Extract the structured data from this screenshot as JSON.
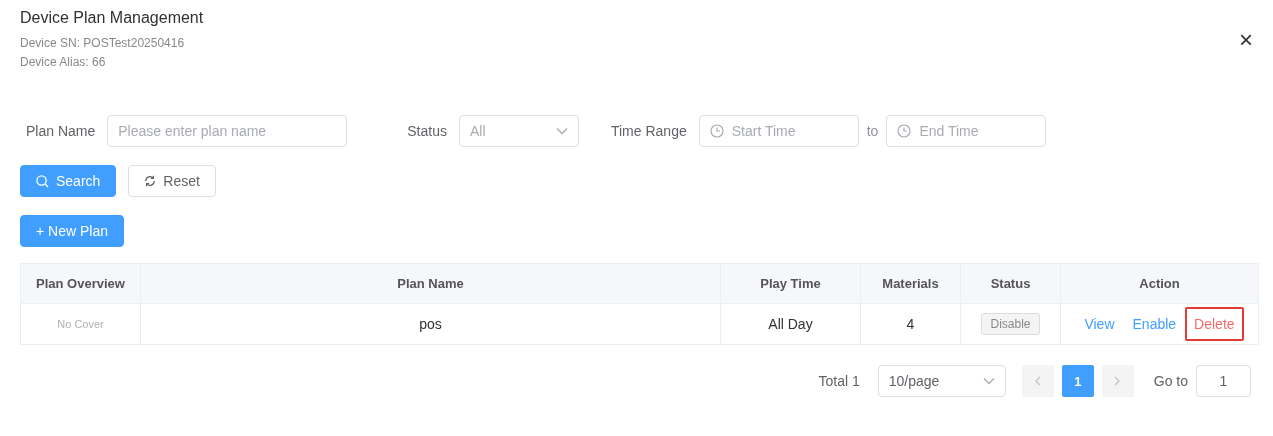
{
  "dialog": {
    "title": "Device Plan Management",
    "subtitles": [
      "Device SN: POSTest20250416",
      "Device Alias: 66"
    ],
    "close": "×"
  },
  "filters": [
    {
      "kind": "text",
      "label": "Plan Name",
      "placeholder": "Please enter plan name"
    },
    {
      "kind": "select",
      "label": "Status",
      "placeholder": "All"
    },
    {
      "kind": "range",
      "label": "Time Range",
      "start_placeholder": "Start Time",
      "separator": "to",
      "end_placeholder": "End Time"
    }
  ],
  "buttons": [
    {
      "kind": "primary",
      "label": "Search"
    },
    {
      "kind": "default",
      "label": "Reset"
    }
  ],
  "new_button": {
    "label": "+ New Plan"
  },
  "table": {
    "columns": [
      "Plan Overview",
      "Plan Name",
      "Play Time",
      "Materials",
      "Status",
      "Action"
    ],
    "rows": [
      {
        "cover": "No Cover",
        "name": "pos",
        "play_time": "All Day",
        "materials": "4",
        "status": "Disable",
        "actions": [
          {
            "label": "View",
            "kind": "link",
            "highlighted": false
          },
          {
            "label": "Enable",
            "kind": "link",
            "highlighted": false
          },
          {
            "label": "Delete",
            "kind": "danger",
            "highlighted": true
          }
        ]
      }
    ]
  },
  "pagination": {
    "total": "Total 1",
    "page_size": "10/page",
    "pages": [
      {
        "label": "1",
        "selected": true
      }
    ],
    "goto_label": "Go to",
    "goto_value": "1"
  }
}
